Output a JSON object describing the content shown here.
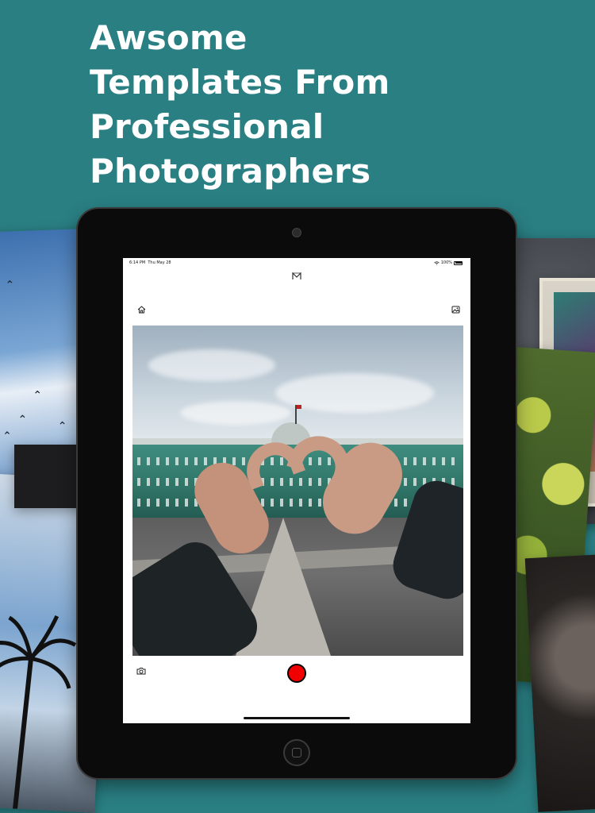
{
  "headline": {
    "lines": [
      "Awsome",
      "Templates From",
      "Professional",
      "Photographers"
    ]
  },
  "status_bar": {
    "time": "6:14 PM",
    "date": "Thu May 28",
    "battery": "100%"
  },
  "icons": {
    "logo": "app-logo-icon",
    "home": "home-icon",
    "gallery": "gallery-icon",
    "camera": "camera-icon",
    "record": "record-icon"
  },
  "colors": {
    "background": "#2a7f83",
    "record": "#f00000",
    "device": "#0b0b0b"
  }
}
